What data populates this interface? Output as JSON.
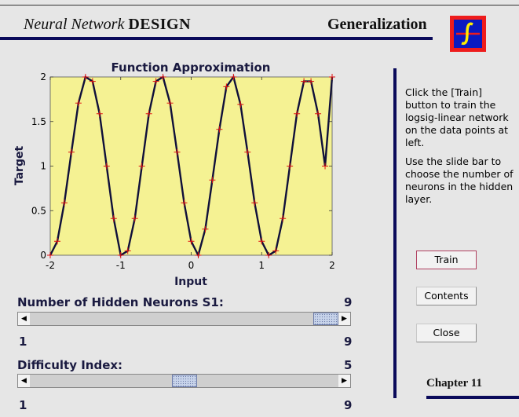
{
  "banner": {
    "title_italic": "Neural Network",
    "title_bold": "DESIGN",
    "section": "Generalization"
  },
  "chart_data": {
    "type": "line",
    "title": "Function Approximation",
    "xlabel": "Input",
    "ylabel": "Target",
    "xlim": [
      -2,
      2
    ],
    "ylim": [
      0,
      2
    ],
    "xticks": [
      "-2",
      "-1",
      "0",
      "1",
      "2"
    ],
    "yticks": [
      "0",
      "0.5",
      "1",
      "1.5",
      "2"
    ],
    "background": "#f5f293",
    "line_color": "#10103a",
    "marker_color": "#e01010",
    "points_x": [
      -2.0,
      -1.9,
      -1.8,
      -1.7,
      -1.6,
      -1.5,
      -1.4,
      -1.3,
      -1.2,
      -1.1,
      -1.0,
      -0.9,
      -0.8,
      -0.7,
      -0.6,
      -0.5,
      -0.4,
      -0.3,
      -0.2,
      -0.1,
      0.0,
      0.1,
      0.2,
      0.3,
      0.4,
      0.5,
      0.6,
      0.7,
      0.8,
      0.9,
      1.0,
      1.1,
      1.2,
      1.3,
      1.4,
      1.5,
      1.6,
      1.7,
      1.8,
      1.9,
      2.0
    ],
    "points_y": [
      0.0,
      0.1564,
      0.5878,
      1.1564,
      1.7071,
      2.0,
      1.9511,
      1.5878,
      1.0,
      0.4122,
      0.0,
      0.0489,
      0.4122,
      1.0,
      1.5878,
      1.9511,
      2.0,
      1.7071,
      1.1564,
      0.5878,
      0.1564,
      0.0,
      0.2929,
      0.8436,
      1.4122,
      1.891,
      2.0,
      1.691,
      1.1564,
      0.5878,
      0.1564,
      0.0,
      0.0489,
      0.4122,
      1.0,
      1.5878,
      1.9511,
      1.9511,
      1.5878,
      1.0,
      2.0
    ]
  },
  "info": {
    "para1": "Click the [Train] button to train the logsig-linear network on the data points at left.",
    "para2": "Use the slide bar to choose the number of neurons in the hidden layer."
  },
  "buttons": {
    "train": "Train",
    "contents": "Contents",
    "close": "Close"
  },
  "neurons": {
    "label": "Number of Hidden Neurons S1:",
    "value": "9",
    "min": "1",
    "max": "9",
    "level_fraction": 1.0
  },
  "difficulty": {
    "label": "Difficulty Index:",
    "value": "5",
    "min": "1",
    "max": "9",
    "level_fraction": 0.5
  },
  "chapter": "Chapter 11",
  "colors": {
    "rule": "#0a0a5a",
    "heading": "#1a1a40",
    "logo_border": "#ee1c1c",
    "logo_bg": "#0a1ac0",
    "logo_glyph": "#ffee00"
  },
  "icons": {
    "left_arrow": "◀",
    "right_arrow": "▶"
  }
}
